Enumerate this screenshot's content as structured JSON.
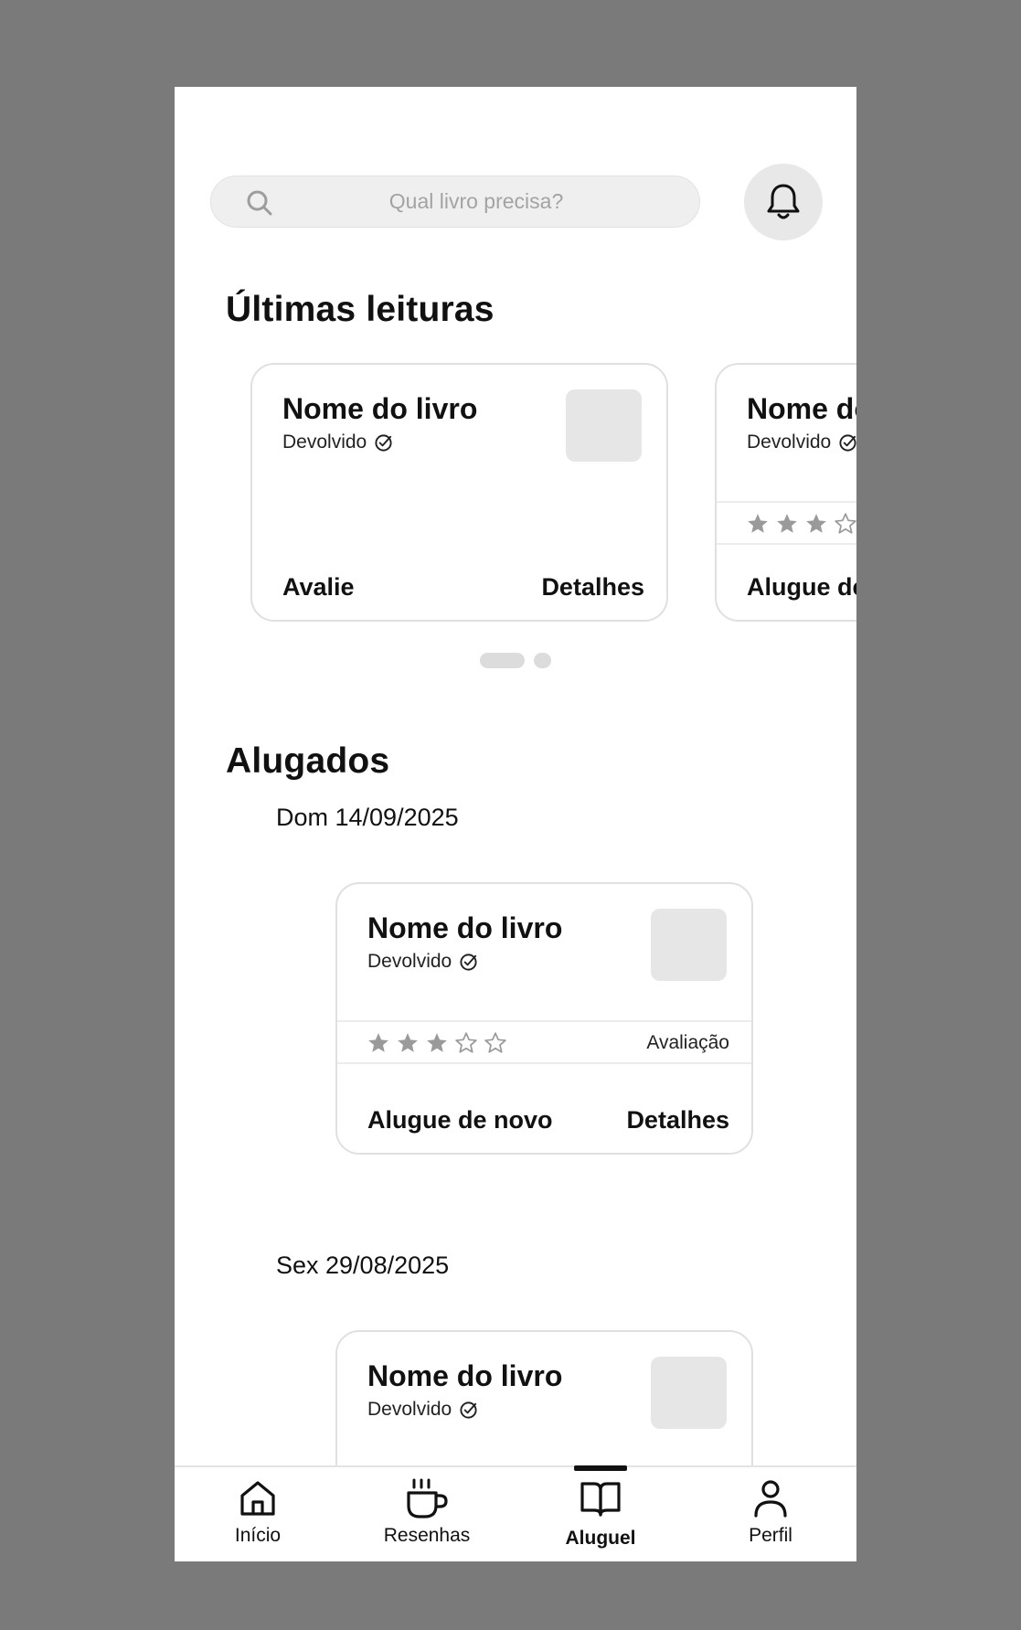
{
  "search": {
    "placeholder": "Qual livro precisa?"
  },
  "icons": {
    "search": "search-icon",
    "notifications": "bell-icon",
    "returned": "check-circle-icon",
    "star": "star-icon"
  },
  "recent": {
    "title": "Últimas leituras",
    "cards": [
      {
        "book_title": "Nome do livro",
        "status": "Devolvido",
        "left_action": "Avalie",
        "right_action": "Detalhes"
      },
      {
        "book_title": "Nome do livro",
        "status": "Devolvido",
        "rating": 3,
        "left_action": "Alugue de novo"
      }
    ],
    "carousel": {
      "active_page": 1,
      "pages": 2
    }
  },
  "rented": {
    "title": "Alugados",
    "groups": [
      {
        "date": "Dom 14/09/2025",
        "card": {
          "book_title": "Nome do livro",
          "status": "Devolvido",
          "rating": 3,
          "rating_label": "Avaliação",
          "left_action": "Alugue de novo",
          "right_action": "Detalhes"
        }
      },
      {
        "date": "Sex 29/08/2025",
        "card": {
          "book_title": "Nome do livro",
          "status": "Devolvido"
        }
      }
    ]
  },
  "nav": {
    "active": "Aluguel",
    "items": [
      {
        "label": "Início",
        "icon": "home-icon"
      },
      {
        "label": "Resenhas",
        "icon": "coffee-cup-icon"
      },
      {
        "label": "Aluguel",
        "icon": "open-book-icon"
      },
      {
        "label": "Perfil",
        "icon": "user-icon"
      }
    ]
  },
  "colors": {
    "background": "#7a7a7a",
    "surface": "#ffffff",
    "placeholder_fill": "#e6e6e6",
    "star_filled": "#9a9a9a",
    "text": "#111111"
  }
}
